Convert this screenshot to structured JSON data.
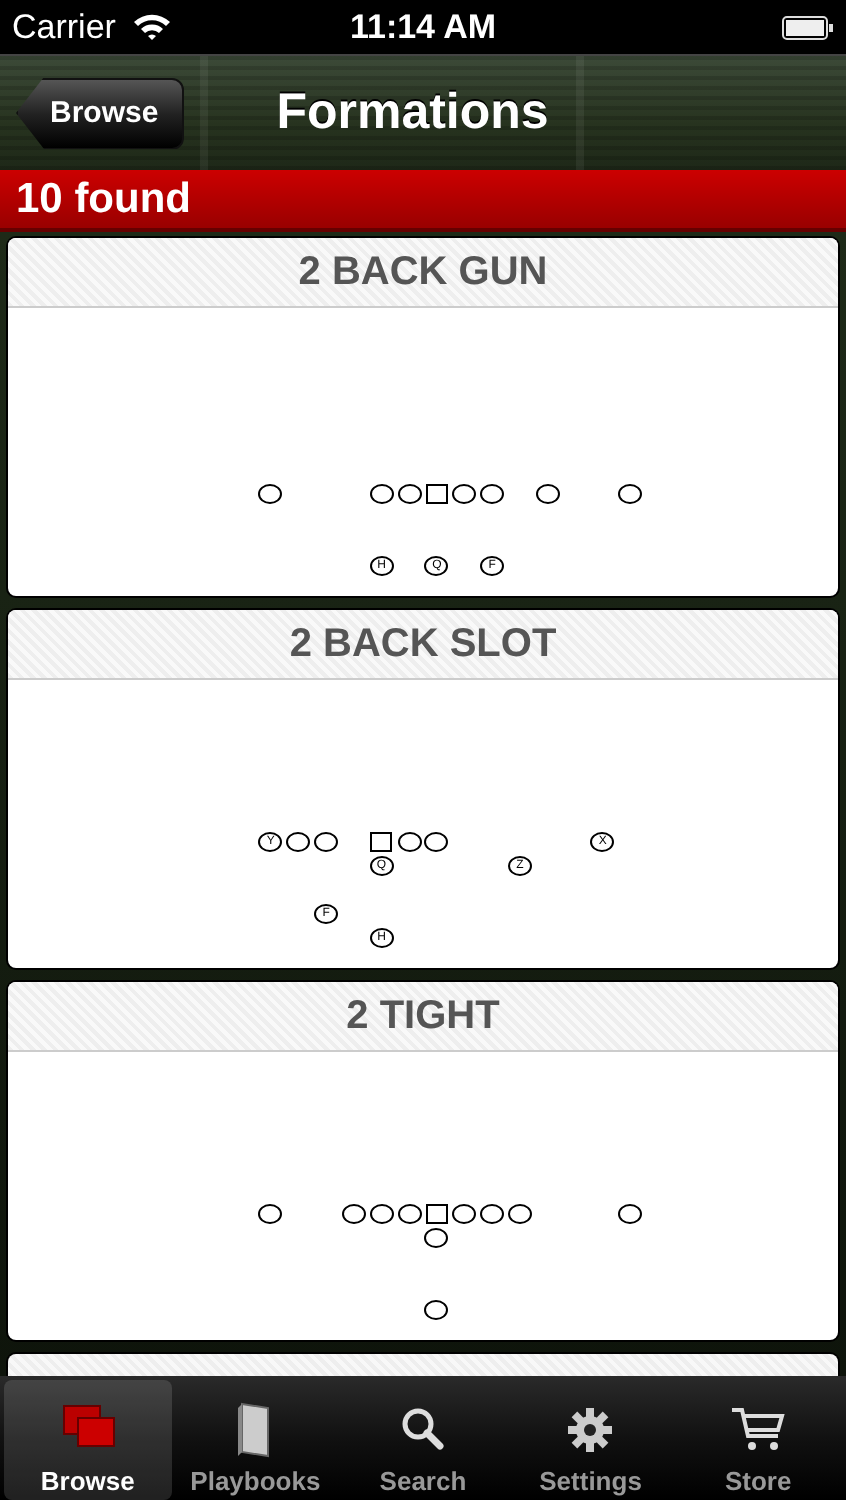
{
  "status_bar": {
    "carrier": "Carrier",
    "time": "11:14 AM"
  },
  "nav_bar": {
    "back_button": "Browse",
    "title": "Formations"
  },
  "result_count": "10 found",
  "formations": [
    {
      "kind": "card",
      "title": "2 BACK GUN",
      "players": [
        {
          "kind": "player"
        },
        {
          "kind": "lineman"
        },
        {
          "kind": "lineman"
        },
        {
          "kind": "center"
        },
        {
          "kind": "lineman"
        },
        {
          "kind": "lineman"
        },
        {
          "kind": "player"
        },
        {
          "kind": "player"
        },
        {
          "kind": "player",
          "label": "H"
        },
        {
          "kind": "player",
          "label": "Q"
        },
        {
          "kind": "player",
          "label": "F"
        }
      ]
    },
    {
      "kind": "card",
      "title": "2 BACK SLOT",
      "players": [
        {
          "kind": "player",
          "label": "Y"
        },
        {
          "kind": "lineman"
        },
        {
          "kind": "lineman"
        },
        {
          "kind": "center"
        },
        {
          "kind": "lineman"
        },
        {
          "kind": "lineman"
        },
        {
          "kind": "player",
          "label": "X"
        },
        {
          "kind": "player",
          "label": "Q"
        },
        {
          "kind": "player",
          "label": "Z"
        },
        {
          "kind": "player",
          "label": "F"
        },
        {
          "kind": "player",
          "label": "H"
        }
      ]
    },
    {
      "kind": "card",
      "title": "2 TIGHT",
      "players": [
        {
          "kind": "player"
        },
        {
          "kind": "player"
        },
        {
          "kind": "lineman"
        },
        {
          "kind": "lineman"
        },
        {
          "kind": "center"
        },
        {
          "kind": "lineman"
        },
        {
          "kind": "lineman"
        },
        {
          "kind": "player"
        },
        {
          "kind": "player"
        },
        {
          "kind": "player"
        },
        {
          "kind": "player"
        }
      ]
    },
    {
      "kind": "peek"
    }
  ],
  "tab_bar": [
    {
      "label": "Browse",
      "selected": true
    },
    {
      "label": "Playbooks",
      "selected": false
    },
    {
      "label": "Search",
      "selected": false
    },
    {
      "label": "Settings",
      "selected": false
    },
    {
      "label": "Store",
      "selected": false
    }
  ]
}
